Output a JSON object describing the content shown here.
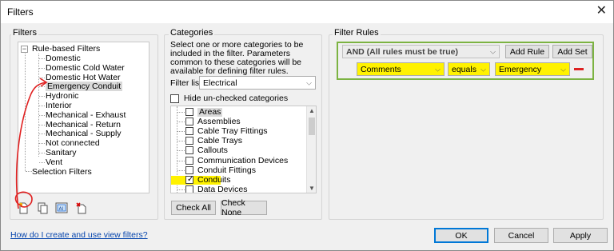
{
  "window": {
    "title": "Filters",
    "close_icon": "close-icon"
  },
  "filters": {
    "group_label": "Filters",
    "tree": {
      "root": "Rule-based Filters",
      "items": [
        "Domestic",
        "Domestic Cold Water",
        "Domestic Hot Water",
        "Emergency Conduit",
        "Hydronic",
        "Interior",
        "Mechanical - Exhaust",
        "Mechanical - Return",
        "Mechanical - Supply",
        "Not connected",
        "Sanitary",
        "Vent"
      ],
      "selected": "Emergency Conduit",
      "selection_filters": "Selection Filters",
      "toggle": "−"
    },
    "toolbar": [
      "new-filter-icon",
      "duplicate-filter-icon",
      "rename-filter-icon",
      "delete-filter-icon"
    ],
    "rename_glyph": "AI"
  },
  "categories": {
    "group_label": "Categories",
    "description": "Select one or more categories to be included in the filter.  Parameters common to these categories will be available for defining filter rules.",
    "filter_list_label": "Filter list:",
    "filter_list_value": "Electrical",
    "hide_unchecked_label": "Hide un-checked categories",
    "items": [
      {
        "label": "Areas",
        "checked": false
      },
      {
        "label": "Assemblies",
        "checked": false
      },
      {
        "label": "Cable Tray Fittings",
        "checked": false
      },
      {
        "label": "Cable Trays",
        "checked": false
      },
      {
        "label": "Callouts",
        "checked": false
      },
      {
        "label": "Communication Devices",
        "checked": false
      },
      {
        "label": "Conduit Fittings",
        "checked": false
      },
      {
        "label": "Conduits",
        "checked": true
      },
      {
        "label": "Data Devices",
        "checked": false
      }
    ],
    "check_all": "Check All",
    "check_none": "Check None"
  },
  "rules": {
    "group_label": "Filter Rules",
    "logic": "AND (All rules must be true)",
    "add_rule": "Add Rule",
    "add_set": "Add Set",
    "parameter": "Comments",
    "operator": "equals",
    "value": "Emergency",
    "remove_icon": "remove-rule-icon"
  },
  "footer": {
    "help_link": "How do I create and use view filters?",
    "ok": "OK",
    "cancel": "Cancel",
    "apply": "Apply"
  },
  "colors": {
    "highlight": "#fff200",
    "annotation": "#e02020",
    "rules_border": "#7cb342"
  }
}
